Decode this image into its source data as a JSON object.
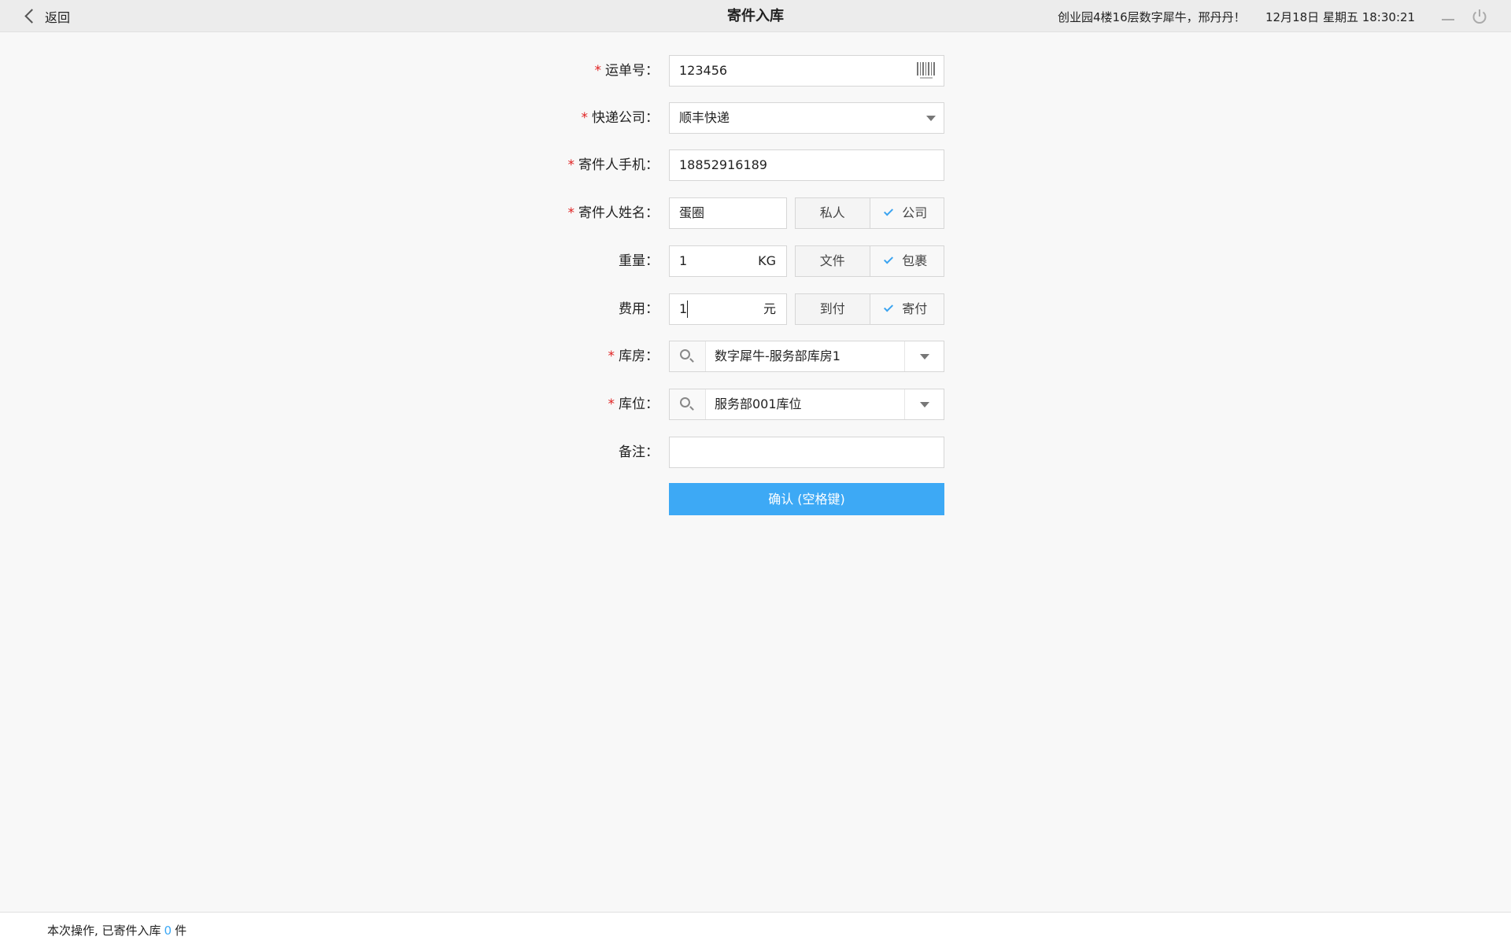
{
  "header": {
    "back_label": "返回",
    "title": "寄件入库",
    "greeting": "创业园4楼16层数字犀牛，邢丹丹！",
    "datetime": "12月18日 星期五 18:30:21"
  },
  "form": {
    "waybill": {
      "label": "运单号：",
      "value": "123456"
    },
    "courier": {
      "label": "快递公司：",
      "value": "顺丰快递"
    },
    "sender_phone": {
      "label": "寄件人手机：",
      "value": "18852916189"
    },
    "sender_name": {
      "label": "寄件人姓名：",
      "value": "蛋圈",
      "options": [
        "私人",
        "公司"
      ],
      "selected": "公司"
    },
    "weight": {
      "label": "重量：",
      "value": "1",
      "unit": "KG",
      "options": [
        "文件",
        "包裹"
      ],
      "selected": "包裹"
    },
    "fee": {
      "label": "费用：",
      "value": "1",
      "unit": "元",
      "options": [
        "到付",
        "寄付"
      ],
      "selected": "寄付"
    },
    "warehouse": {
      "label": "库房：",
      "value": "数字犀牛-服务部库房1"
    },
    "location": {
      "label": "库位：",
      "value": "服务部001库位"
    },
    "remark": {
      "label": "备注：",
      "value": ""
    },
    "required_mark": "*",
    "confirm_label": "确认 (空格键)"
  },
  "footer": {
    "prefix": "本次操作, 已寄件入库",
    "count": "0",
    "suffix": "件"
  },
  "colors": {
    "accent": "#3da9f5",
    "required": "#e02020",
    "topbar": "#ececec",
    "background": "#f8f8f8"
  },
  "icons": [
    "chevron-left-icon",
    "minimize-icon",
    "power-icon",
    "barcode-icon",
    "dropdown-arrow-icon",
    "search-icon",
    "check-icon"
  ]
}
